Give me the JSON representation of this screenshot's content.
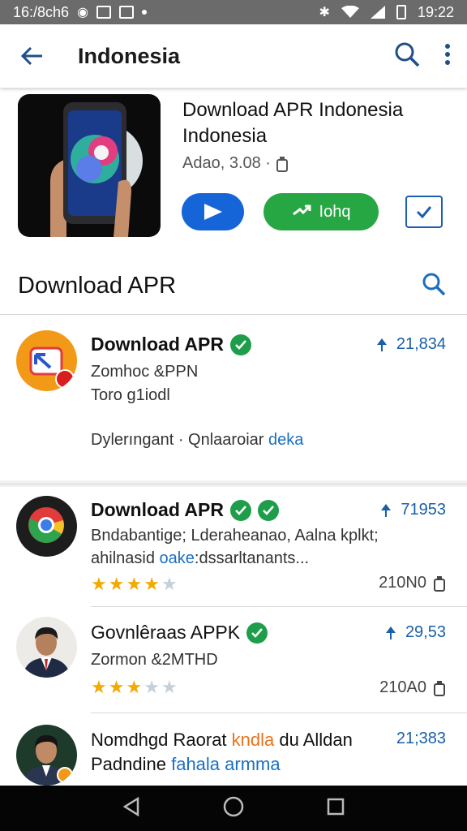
{
  "status_bar": {
    "time_left": "16:/8ch6",
    "time_right": "19:22"
  },
  "app_bar": {
    "title": "Indonesia"
  },
  "hero": {
    "name": "Download APR Indonesia Indonesia",
    "meta": "Adao, 3.08 ·",
    "install_label": "Iohq"
  },
  "section": {
    "title": "Download APR"
  },
  "items": [
    {
      "title": "Download APR",
      "line1": "Zomhoc &PPN",
      "line2": "Toro g1iodl",
      "line3_main": "Dylerıngant · Qnlaaroiar ",
      "line3_accent": "deka",
      "count": "21,834"
    },
    {
      "title": "Download APR",
      "line1": "Bndabantige; Lderaheanao, Aalna kplkt;",
      "line2_main": "ahilnasid ",
      "line2_accent": "oake",
      "line2_rest": ":dssarltanants...",
      "count": "71953",
      "size": "210N0",
      "rating": 4
    },
    {
      "title": "Govnlêraas APPK",
      "line1": "Zormon &2MTHD",
      "count": "29,53",
      "size": "210A0",
      "rating": 3
    },
    {
      "title_main": "Nomdhgd Raorat ",
      "title_accent": "kndla",
      "title_rest": " du Alldan",
      "line1_main": "Padndine ",
      "line1_accent": "fahala armma",
      "count": "21;383"
    }
  ],
  "colors": {
    "primary_blue": "#1565d8",
    "install_green": "#27a744",
    "verified_green": "#1e9e4a",
    "star": "#f2a900",
    "link_blue": "#1a6fc2"
  }
}
